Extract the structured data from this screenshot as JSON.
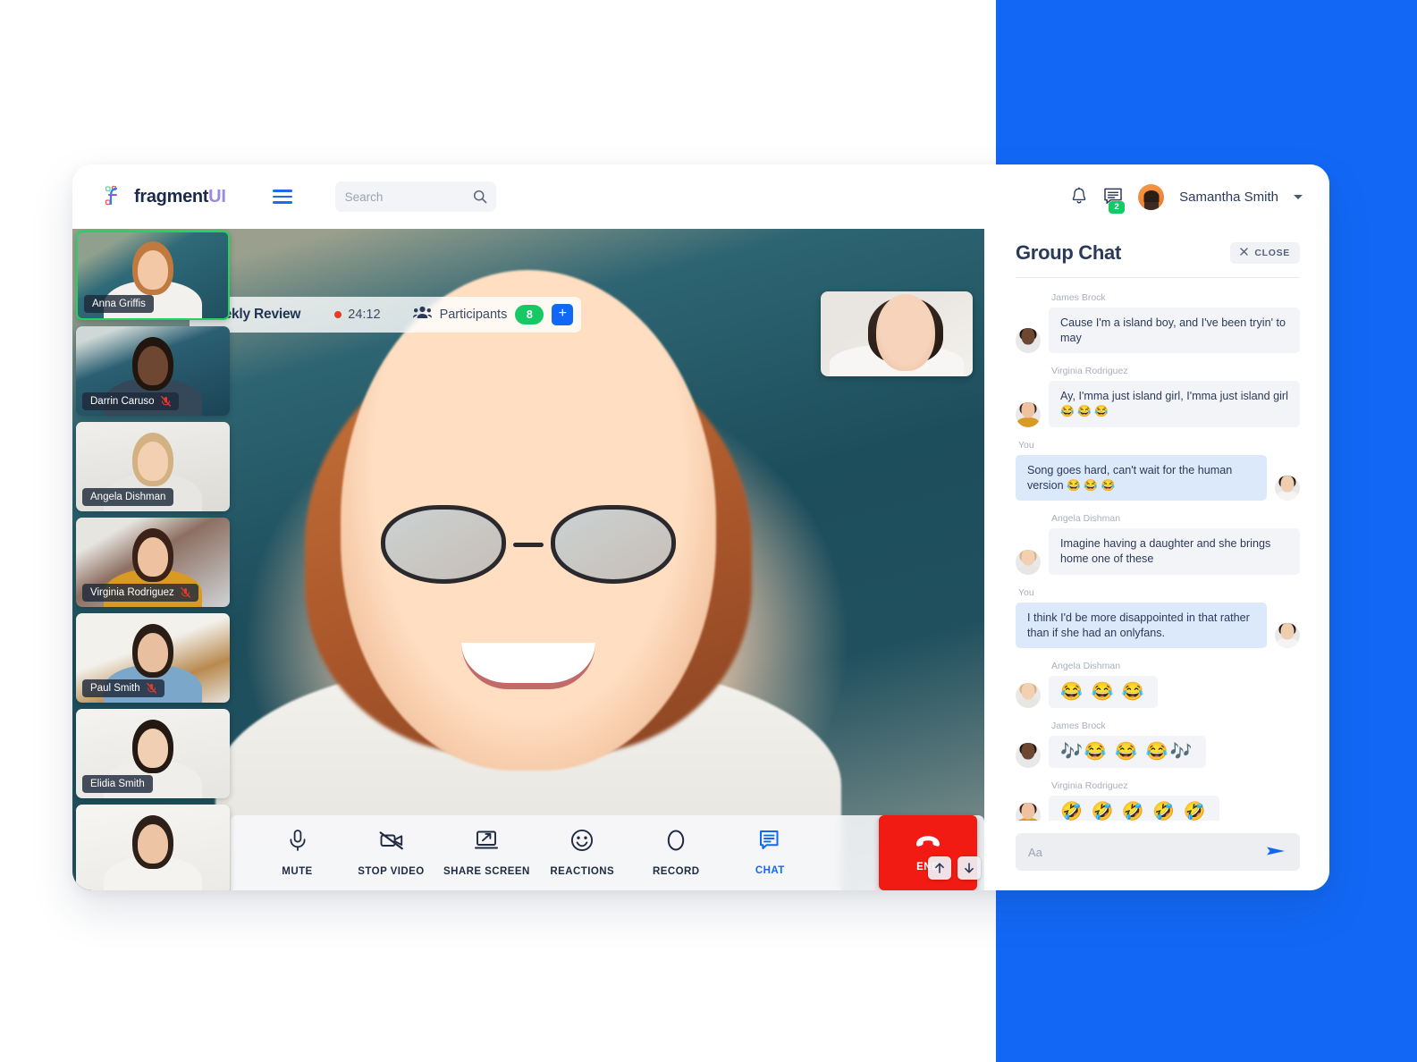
{
  "brand": {
    "name": "fragment",
    "suffix": "UI"
  },
  "topbar": {
    "menu_icon": "hamburger-icon",
    "search": {
      "placeholder": "Search",
      "value": "",
      "icon": "search-icon"
    },
    "notifications_icon": "bell-icon",
    "messages_icon": "chat-icon",
    "messages_badge": "2",
    "user": {
      "name": "Samantha Smith",
      "avatar": "user-avatar",
      "caret": "chevron-down-icon"
    }
  },
  "meeting": {
    "title": "Weekly Review",
    "recording_dot": true,
    "elapsed": "24:12",
    "participants_icon": "people-icon",
    "participants_label": "Participants",
    "participants_count": "8",
    "add_participant_label": "+",
    "self_view_label": "self-view",
    "rail_nav": {
      "up": "arrow-up-icon",
      "down": "arrow-down-icon"
    },
    "thumbnails": [
      {
        "name": "Anna Griffis",
        "muted": false,
        "active": true,
        "bg": "bg1",
        "skin": "#f2c8a6",
        "hair": "#c07a3f",
        "shirt": "#f2f1ee"
      },
      {
        "name": "Darrin Caruso",
        "muted": true,
        "active": false,
        "bg": "bg2",
        "skin": "#6d4731",
        "hair": "#20150f",
        "shirt": "#35485a"
      },
      {
        "name": "Angela Dishman",
        "muted": false,
        "active": false,
        "bg": "bg3",
        "skin": "#f3d0b2",
        "hair": "#d4b183",
        "shirt": "#e7e6e2"
      },
      {
        "name": "Virginia Rodriguez",
        "muted": true,
        "active": false,
        "bg": "bg4",
        "skin": "#eec2a0",
        "hair": "#3a2218",
        "shirt": "#d99a23"
      },
      {
        "name": "Paul Smith",
        "muted": true,
        "active": false,
        "bg": "bg5",
        "skin": "#e8c0a0",
        "hair": "#2a1d16",
        "shirt": "#7ba7cb"
      },
      {
        "name": "Elidia Smith",
        "muted": false,
        "active": false,
        "bg": "bg6",
        "skin": "#f0cfb2",
        "hair": "#231812",
        "shirt": "#efeeeb"
      },
      {
        "name": "",
        "muted": false,
        "active": false,
        "bg": "bg7",
        "skin": "#eec5a4",
        "hair": "#2d2018",
        "shirt": "#f4f3f0"
      }
    ],
    "controls": [
      {
        "label": "MUTE",
        "icon": "microphone-icon",
        "active": false
      },
      {
        "label": "STOP VIDEO",
        "icon": "video-off-icon",
        "active": false
      },
      {
        "label": "SHARE SCREEN",
        "icon": "share-screen-icon",
        "active": false
      },
      {
        "label": "REACTIONS",
        "icon": "smiley-icon",
        "active": false
      },
      {
        "label": "RECORD",
        "icon": "record-circle-icon",
        "active": false
      },
      {
        "label": "CHAT",
        "icon": "chat-bubble-icon",
        "active": true
      }
    ],
    "end_button": {
      "label": "END",
      "icon": "phone-hangup-icon",
      "color": "#f11b13"
    }
  },
  "chat": {
    "title": "Group Chat",
    "close_label": "CLOSE",
    "close_icon": "close-icon",
    "messages": [
      {
        "author": "James Brock",
        "text": "Cause I'm a island boy, and I've been tryin' to may",
        "me": false,
        "emoji": false,
        "skin": "#6d4731",
        "hair": "#1b120d",
        "shirt": "#e8e8e8"
      },
      {
        "author": "Virginia Rodriguez",
        "text": "Ay, I'mma just island girl, I'mma just island girl 😂 😂 😂",
        "me": false,
        "emoji": false,
        "skin": "#eec2a0",
        "hair": "#3a2218",
        "shirt": "#d99a23"
      },
      {
        "author": "You",
        "text": "Song goes hard, can't wait for the human version  😂 😂 😂",
        "me": true,
        "emoji": false,
        "skin": "#efcdb0",
        "hair": "#241a14",
        "shirt": "#f5f4f2"
      },
      {
        "author": "Angela Dishman",
        "text": "Imagine having a daughter and she brings home one of these",
        "me": false,
        "emoji": false,
        "skin": "#f3d0b2",
        "hair": "#d4b183",
        "shirt": "#e7e6e2"
      },
      {
        "author": "You",
        "text": "I think I'd be more disappointed in that rather than if she had an onlyfans.",
        "me": true,
        "emoji": false,
        "skin": "#efcdb0",
        "hair": "#241a14",
        "shirt": "#f5f4f2"
      },
      {
        "author": "Angela Dishman",
        "text": "😂 😂 😂",
        "me": false,
        "emoji": true,
        "skin": "#f3d0b2",
        "hair": "#d4b183",
        "shirt": "#e7e6e2"
      },
      {
        "author": "James Brock",
        "text": "🎶😂 😂 😂🎶",
        "me": false,
        "emoji": true,
        "skin": "#6d4731",
        "hair": "#1b120d",
        "shirt": "#e8e8e8"
      },
      {
        "author": "Virginia Rodriguez",
        "text": "🤣 🤣 🤣 🤣 🤣",
        "me": false,
        "emoji": true,
        "skin": "#eec2a0",
        "hair": "#3a2218",
        "shirt": "#d99a23"
      }
    ],
    "composer": {
      "placeholder": "Aa",
      "value": "",
      "send_icon": "send-icon"
    }
  },
  "colors": {
    "brand_blue": "#1268f5",
    "accent_green": "#17c964",
    "danger_red": "#f11b13",
    "panel_bg": "#1268f5"
  }
}
